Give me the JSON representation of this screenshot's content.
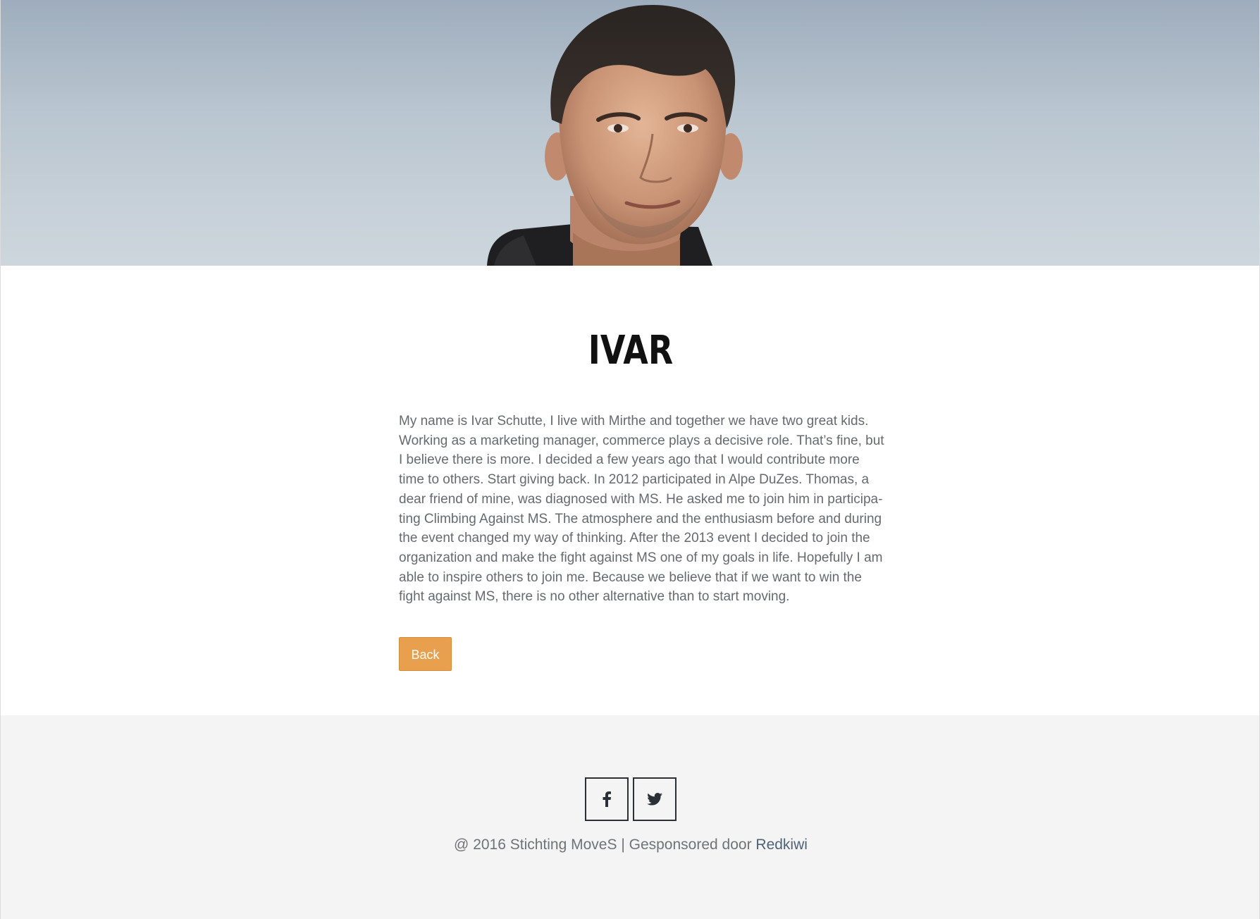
{
  "hero": {
    "image": "portrait-photo",
    "sky_color": "#b8c4cf"
  },
  "profile": {
    "name": "IVAR",
    "bio_lines": [
      "My name is Ivar Schutte, I live with Mirthe and together we have two great kids.",
      "Working as a marketing manager, commerce plays a decisive role. That’s fine, but",
      "I believe there is more. I decided a few years ago that I would contribute more",
      "time to others. Start giving back. In 2012 participated in Alpe DuZes. Thomas, a",
      "dear friend of mine, was diagnosed with MS. He asked me to join him in participa-",
      "ting Climbing Against MS. The atmosphere and the enthusiasm before and during",
      "the event changed my way of thinking. After the 2013 event I decided to join the",
      "organization and make the fight against MS one of my goals in life. Hopefully I am",
      "able to inspire others to join me. Because we believe that if we want to win the",
      "fight against MS, there is no other alternative than to start moving."
    ],
    "back_label": "Back",
    "accent_color": "#e8a04e"
  },
  "footer": {
    "social": [
      {
        "icon": "facebook-icon"
      },
      {
        "icon": "twitter-icon"
      }
    ],
    "copyright_text": "@ 2016 Stichting MoveS | Gesponsored door ",
    "sponsor_link": "Redkiwi",
    "background_color": "#f4f4f4"
  }
}
